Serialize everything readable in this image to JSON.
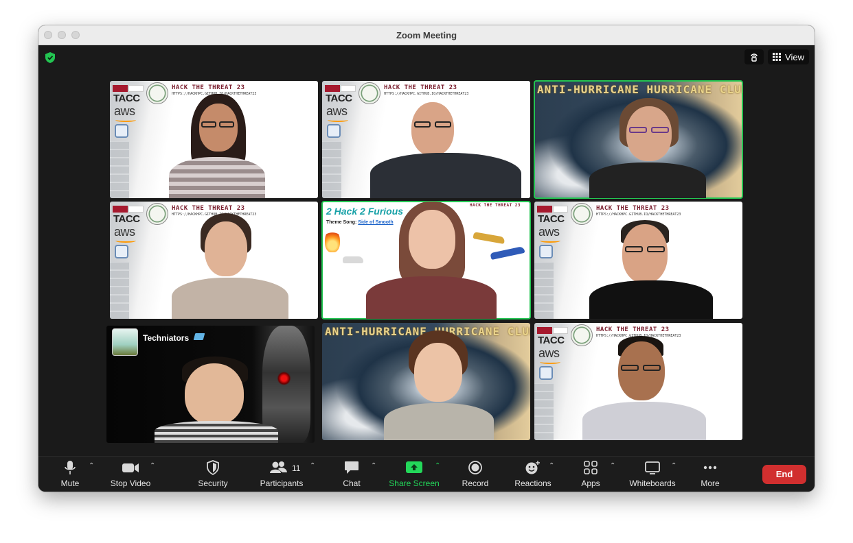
{
  "window": {
    "title": "Zoom Meeting"
  },
  "top_right": {
    "view_label": "View"
  },
  "tiles": {
    "hack_title": "HACK THE THREAT 23",
    "hack_url": "HTTPS://HACKHPC.GITHUB.IO/HACKTHETHREAT23",
    "tacc": "TACC",
    "aws": "aws",
    "sfu": "SFU",
    "storm_title": "ANTI-HURRICANE HURRICANE CLUB",
    "ff_title": "2 Hack 2 Furious",
    "ff_song_label": "Theme Song:",
    "ff_song_link": "Side of Smooth",
    "team_name": "Techniators"
  },
  "toolbar": {
    "mute": "Mute",
    "stop_video": "Stop Video",
    "security": "Security",
    "participants": "Participants",
    "participants_count": "11",
    "chat": "Chat",
    "share_screen": "Share Screen",
    "record": "Record",
    "reactions": "Reactions",
    "apps": "Apps",
    "whiteboards": "Whiteboards",
    "more": "More",
    "end": "End"
  },
  "colors": {
    "share_accent": "#23d85a",
    "end_button": "#d12f2f",
    "active_speaker_border": "#23c552",
    "security_shield": "#23c552"
  }
}
